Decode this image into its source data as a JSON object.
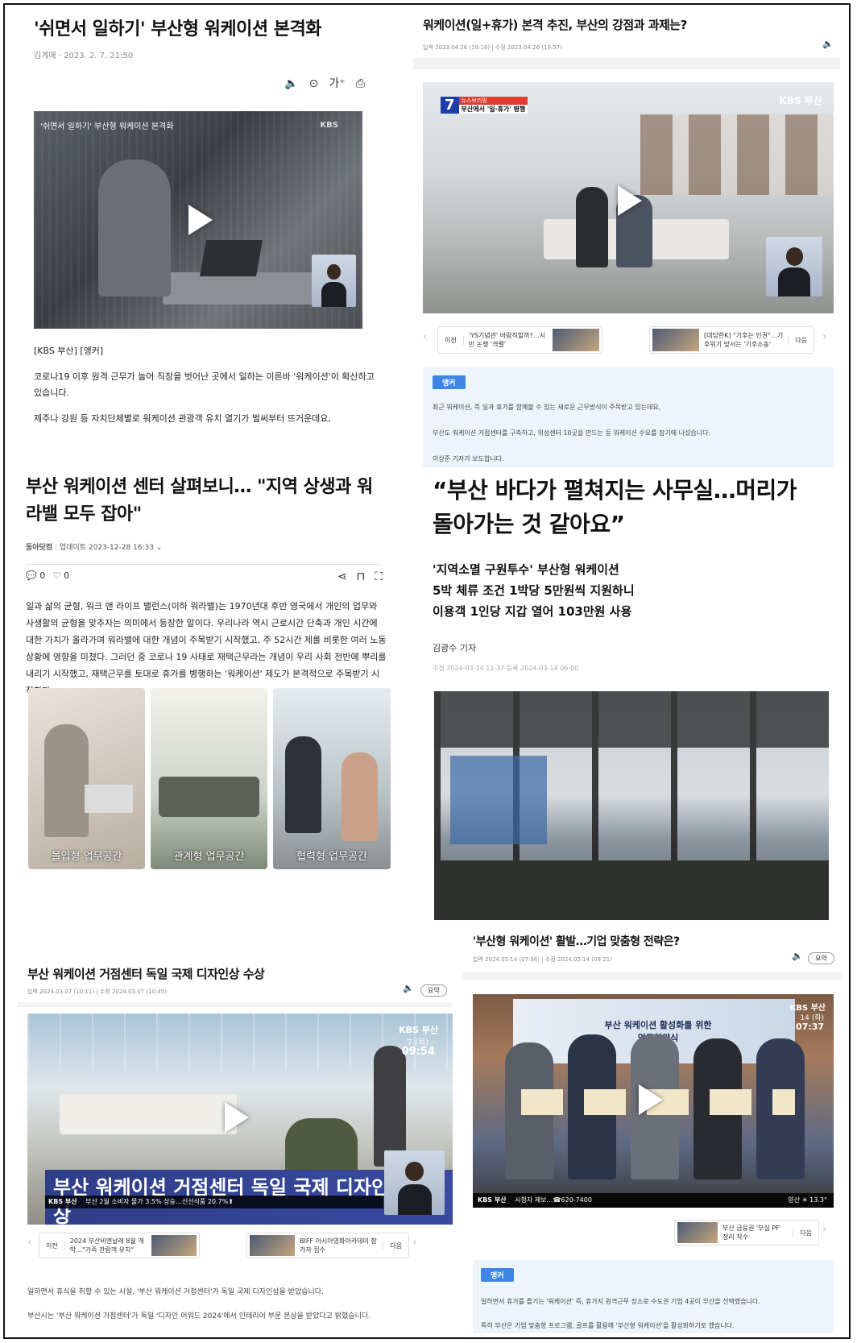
{
  "a1": {
    "title": "'쉬면서 일하기' 부산형 워케이션 본격화",
    "byline": "김계애 · 2023. 2. 7. 21:50",
    "video_overlay": "'쉬면서 일하기' 부산형 워케이션 본격화",
    "video_logo": "KBS",
    "tag": "[KBS 부산] [앵커]",
    "para1": "코로나19 이후 원격 근무가 늘어 직장을 벗어난 곳에서 일하는 이른바 '워케이션'이 확산하고 있습니다.",
    "para2": "제주나 강원 등 자치단체별로 워케이션 관광객 유치 열기가 벌써부터 뜨거운데요,"
  },
  "a2": {
    "title": "부산 워케이션 센터 살펴보니… \"지역 상생과 워라밸 모두 잡아\"",
    "source": "동아닷컴",
    "updated": "업데이트 2023-12-28 16:33",
    "comments": "0",
    "likes": "0",
    "body": "일과 삶의 균형, 워크 앤 라이프 밸런스(이하 워라밸)는 1970년대 후반 영국에서 개인의 업무와 사생활의 균형을 맞추자는 의미에서 등장한 말이다. 우리나라 역시 근로시간 단축과 개인 시간에 대한 가치가 올라가며 워라밸에 대한 개념이 주목받기 시작했고, 주 52시간 제를 비롯한 여러 노동 상황에 영향을 미쳤다. 그러던 중 코로나 19 사태로 재택근무라는 개념이 우리 사회 전반에 뿌리를 내리기 시작했고, 재택근무를 토대로 휴가를 병행하는 '워케이션' 제도가 본격적으로 주목받기 시작한다.",
    "photos": [
      "몰입형 업무공간",
      "관계형 업무공간",
      "협력형 업무공간"
    ]
  },
  "a3": {
    "title": "부산 워케이션 거점센터 독일 국제 디자인상 수상",
    "dates": "입력 2024.03.07 (10:11)  |  수정 2024.03.07 (10:45)",
    "summary": "요약",
    "logo": "KBS 부산",
    "clock_date": "7 (목)",
    "clock_time": "09:54",
    "caption": "부산 워케이션 거점센터 독일 국제 디자인상 수상",
    "ticker_brand": "KBS 부산",
    "ticker": "부산 2월 소비자 물가 3.5% 상승…신선식품 20.7%⬆",
    "prev_label": "이전",
    "prev_text": "2024 부산비엔날레 8월 개막…\"가족 관람객 유치\"",
    "next_text": "BIFF 아시아영화아카데미 참가자 접수",
    "next_label": "다음",
    "para1": "일하면서 휴식을 취할 수 있는 시설, '부산 워케이션 거점센터'가 독일 국제 디자인상을 받았습니다.",
    "para2": "부산시는 '부산 워케이션 거점센터'가 독일 '디자인 어워드 2024'에서 인테리어 부문 본상을 받았다고 밝혔습니다."
  },
  "b1": {
    "title": "워케이션(일+휴가) 본격 추진, 부산의 강점과 과제는?",
    "dates": "입력 2023.04.26 (19:18)  |  수정 2023.04.26 (19:57)",
    "bug_num": "7",
    "bug_top": "뉴스브리핑",
    "bug_text": "부산에서 '일·휴가' 병행",
    "logo": "KBS 부산",
    "prev_label": "이전",
    "prev_text": "'YS기념관' 바람직할까?…시민 논쟁 '격렬'",
    "next_text": "[대담한K] \"기후는 인권\"…기후위기 맞서는 '기후소송'",
    "next_label": "다음",
    "anchor": "앵커",
    "line1": "최근 워케이션, 즉 일과 휴가를 함께할 수 있는 새로운 근무방식이 주목받고 있는데요,",
    "line2": "부산도 워케이션 거점센터를 구축하고, 위성센터 10곳을 만드는 등 워케이션 수요를 잡기에 나섰습니다.",
    "line3": "이상준 기자가 보도합니다."
  },
  "b2": {
    "title": "“부산 바다가 펼쳐지는 사무실…머리가 돌아가는 것 같아요”",
    "sub1": "'지역소멸 구원투수' 부산형 워케이션",
    "sub2": "5박 체류 조건 1박당 5만원씩 지원하니",
    "sub3": "이용객 1인당 지갑 열어 103만원 사용",
    "reporter": "김광수 기자",
    "dates": "수정 2024-03-14 11:37   등록 2024-03-14 06:00"
  },
  "b3": {
    "title": "'부산형 워케이션' 활발…기업 맞춤형 전략은?",
    "dates": "입력 2024.05.14 (07:36)  |  수정 2024.05.14 (09:21)",
    "summary": "요약",
    "logo": "KBS 부산",
    "clock_date": "14 (화)",
    "clock_time": "07:37",
    "banner": "부산 워케이션 활성화를 위한 업무협약식",
    "ticker_brand": "KBS 부산",
    "ticker": "시청자 제보…☎620-7400",
    "weather": "양산 ☀ 13.3°",
    "next_text": "부산 금융권 '부실 PF' 정리 착수",
    "next_label": "다음",
    "anchor": "앵커",
    "line1": "일하면서 휴가를 즐기는 '워케이션' 즉, 휴가지 원격근무 장소로 수도권 기업 4곳이 부산을 선택했습니다.",
    "line2": "특히 부산은 기업 맞춤형 프로그램, 골프를 활용해 '부산형 워케이션'을 활성화하기로 했습니다."
  }
}
